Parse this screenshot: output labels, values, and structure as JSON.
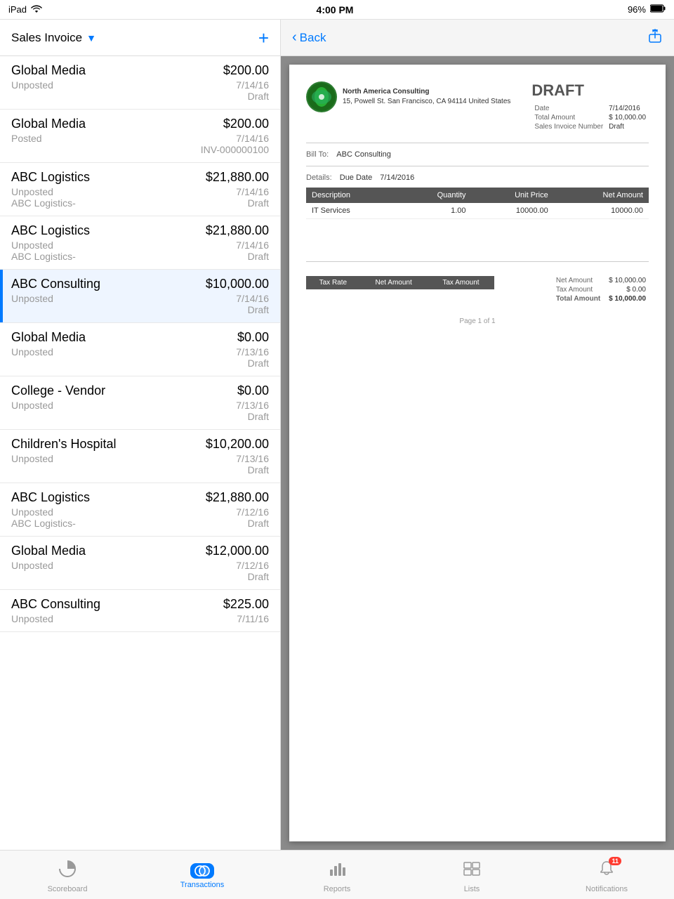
{
  "statusBar": {
    "device": "iPad",
    "time": "4:00 PM",
    "battery": "96%",
    "wifi": "wifi"
  },
  "leftPanel": {
    "title": "Sales Invoice",
    "addLabel": "+",
    "invoices": [
      {
        "name": "Global Media",
        "amount": "$200.00",
        "status": "Unposted",
        "date": "7/14/16",
        "ref": "Draft"
      },
      {
        "name": "Global Media",
        "amount": "$200.00",
        "status": "Posted",
        "date": "7/14/16",
        "ref": "INV-000000100"
      },
      {
        "name": "ABC Logistics",
        "amount": "$21,880.00",
        "status": "Unposted",
        "date": "7/14/16",
        "ref": "ABC Logistics-     Draft"
      },
      {
        "name": "ABC Logistics",
        "amount": "$21,880.00",
        "status": "Unposted",
        "date": "7/14/16",
        "ref": "ABC Logistics-     Draft"
      },
      {
        "name": "ABC Consulting",
        "amount": "$10,000.00",
        "status": "Unposted",
        "date": "7/14/16",
        "ref": "Draft",
        "selected": true
      },
      {
        "name": "Global Media",
        "amount": "$0.00",
        "status": "Unposted",
        "date": "7/13/16",
        "ref": "Draft"
      },
      {
        "name": "College - Vendor",
        "amount": "$0.00",
        "status": "Unposted",
        "date": "7/13/16",
        "ref": "Draft"
      },
      {
        "name": "Children's Hospital",
        "amount": "$10,200.00",
        "status": "Unposted",
        "date": "7/13/16",
        "ref": "Draft"
      },
      {
        "name": "ABC Logistics",
        "amount": "$21,880.00",
        "status": "Unposted",
        "date": "7/12/16",
        "ref": "ABC Logistics-     Draft"
      },
      {
        "name": "Global Media",
        "amount": "$12,000.00",
        "status": "Unposted",
        "date": "7/12/16",
        "ref": "Draft"
      },
      {
        "name": "ABC Consulting",
        "amount": "$225.00",
        "status": "Unposted",
        "date": "7/11/16",
        "ref": ""
      }
    ]
  },
  "rightPanel": {
    "backLabel": "Back",
    "invoice": {
      "companyName": "North America Consulting",
      "companyAddress": "15, Powell St. San Francisco, CA 94114 United States",
      "draftLabel": "DRAFT",
      "dateLabel": "Date",
      "dateValue": "7/14/2016",
      "totalAmountLabel": "Total Amount",
      "totalAmountValue": "$ 10,000.00",
      "salesInvoiceNumberLabel": "Sales Invoice Number",
      "salesInvoiceNumberValue": "Draft",
      "billToLabel": "Bill To:",
      "billToValue": "ABC Consulting",
      "detailsLabel": "Details:",
      "dueDateLabel": "Due Date",
      "dueDateValue": "7/14/2016",
      "tableHeaders": [
        "Description",
        "Quantity",
        "Unit Price",
        "Net Amount"
      ],
      "tableRows": [
        {
          "description": "IT Services",
          "quantity": "1.00",
          "unitPrice": "10000.00",
          "netAmount": "10000.00"
        }
      ],
      "taxTableHeaders": [
        "Tax Rate",
        "Net Amount",
        "Tax Amount"
      ],
      "netAmountLabel": "Net Amount",
      "netAmountValue": "$ 10,000.00",
      "taxAmountLabel": "Tax Amount",
      "taxAmountValue": "$ 0.00",
      "totalAmountSummaryLabel": "Total Amount",
      "totalAmountSummaryValue": "$ 10,000.00",
      "pageLabel": "Page 1 of 1"
    }
  },
  "tabBar": {
    "tabs": [
      {
        "id": "scoreboard",
        "label": "Scoreboard",
        "icon": "pie-chart",
        "active": false
      },
      {
        "id": "transactions",
        "label": "Transactions",
        "icon": "transactions",
        "active": true
      },
      {
        "id": "reports",
        "label": "Reports",
        "icon": "bar-chart",
        "active": false
      },
      {
        "id": "lists",
        "label": "Lists",
        "icon": "lists",
        "active": false
      },
      {
        "id": "notifications",
        "label": "Notifications",
        "icon": "bell",
        "active": false,
        "badge": "11"
      }
    ]
  }
}
